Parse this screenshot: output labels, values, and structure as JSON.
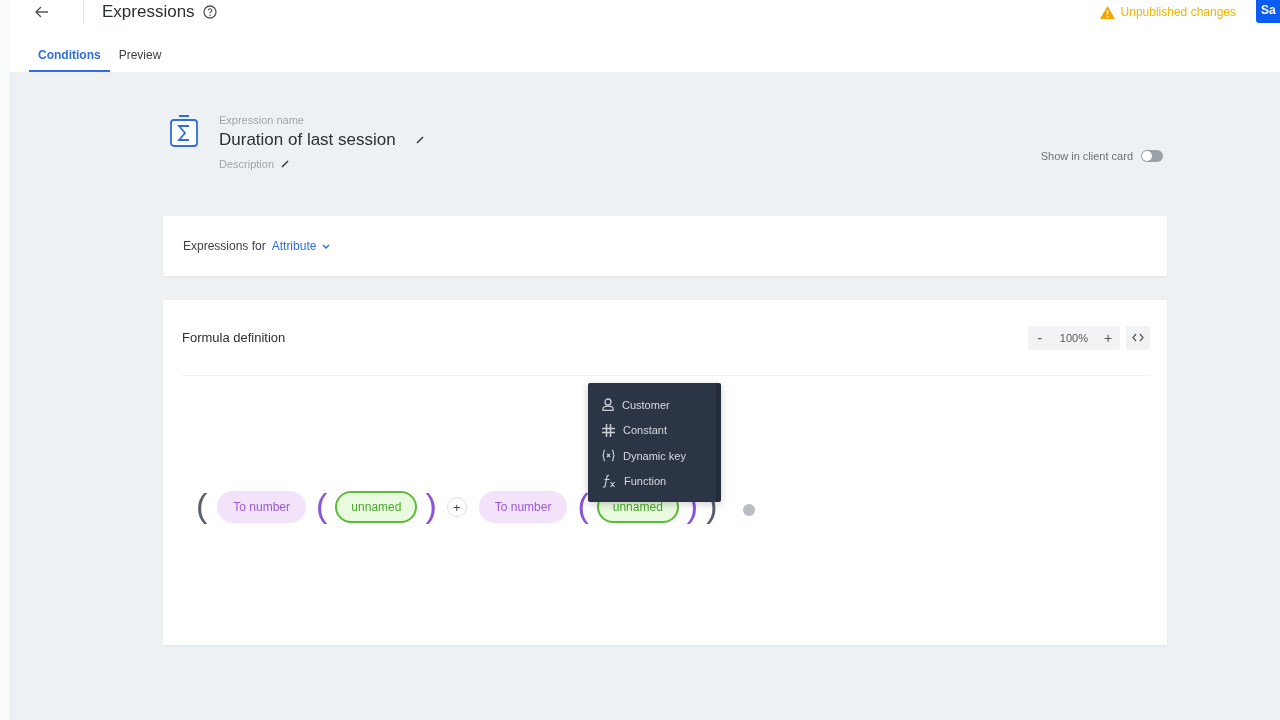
{
  "header": {
    "title": "Expressions",
    "status": "Unpublished changes",
    "save_button": "Sa"
  },
  "tabs": [
    {
      "label": "Conditions",
      "selected": true
    },
    {
      "label": "Preview",
      "selected": false
    }
  ],
  "expression": {
    "name_label": "Expression name",
    "name": "Duration of last session",
    "description": "Description",
    "client_card_label": "Show in client card",
    "client_card_on": false
  },
  "expressions_for": {
    "label": "Expressions for",
    "value": "Attribute"
  },
  "formula": {
    "title": "Formula definition",
    "zoom": "100%",
    "zoom_out": "-",
    "zoom_in": "+",
    "tokens": [
      {
        "kind": "paren",
        "text": "(",
        "color": "#5a606b"
      },
      {
        "kind": "function",
        "text": "To number"
      },
      {
        "kind": "paren",
        "text": "(",
        "color": "#8b55d9"
      },
      {
        "kind": "variable",
        "text": "unnamed"
      },
      {
        "kind": "paren",
        "text": ")",
        "color": "#8b55d9"
      },
      {
        "kind": "operator",
        "text": "+"
      },
      {
        "kind": "function",
        "text": "To number"
      },
      {
        "kind": "paren",
        "text": "(",
        "color": "#8b55d9"
      },
      {
        "kind": "variable",
        "text": "unnamed"
      },
      {
        "kind": "paren",
        "text": ")",
        "color": "#8b55d9"
      },
      {
        "kind": "paren",
        "text": ")",
        "color": "#5a606b"
      },
      {
        "kind": "add"
      }
    ],
    "menu": [
      {
        "kind": "customer",
        "label": "Customer"
      },
      {
        "kind": "constant",
        "label": "Constant"
      },
      {
        "kind": "dynamic",
        "label": "Dynamic key"
      },
      {
        "kind": "function",
        "label": "Function"
      }
    ]
  }
}
